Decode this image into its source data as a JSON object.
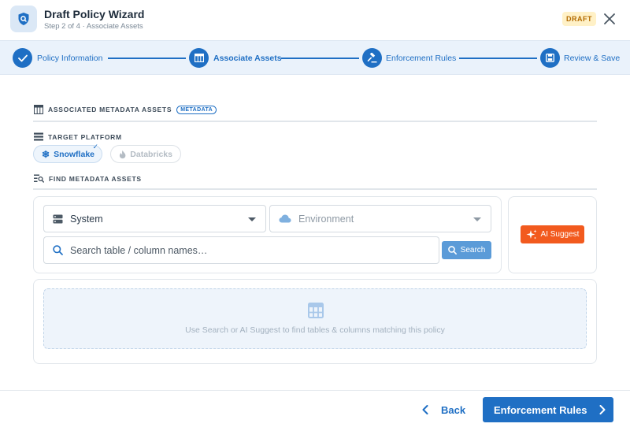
{
  "header": {
    "title": "Draft Policy Wizard",
    "subtitle": "Step 2 of 4 · Associate Assets",
    "status_badge": "DRAFT"
  },
  "stepper": {
    "steps": [
      {
        "label": "Policy Information",
        "state": "complete",
        "icon": "check-icon"
      },
      {
        "label": "Associate Assets",
        "state": "current",
        "icon": "table-icon"
      },
      {
        "label": "Enforcement Rules",
        "state": "upcoming",
        "icon": "gavel-icon"
      },
      {
        "label": "Review & Save",
        "state": "upcoming",
        "icon": "save-icon"
      }
    ]
  },
  "assets_section": {
    "title": "ASSOCIATED METADATA ASSETS",
    "tag": "METADATA"
  },
  "platform_section": {
    "title": "TARGET PLATFORM",
    "options": [
      {
        "label": "Snowflake",
        "selected": true,
        "icon": "snowflake-icon"
      },
      {
        "label": "Databricks",
        "selected": false,
        "icon": "flame-icon"
      }
    ]
  },
  "find_section": {
    "title": "FIND METADATA ASSETS",
    "system_select": "System",
    "environment_select": "Environment",
    "search_placeholder": "Search table / column names…",
    "search_button": "Search",
    "ai_suggest_button": "AI Suggest",
    "empty_message": "Use Search or AI Suggest to find tables & columns matching this policy"
  },
  "footer": {
    "back_label": "Back",
    "next_label": "Enforcement Rules"
  },
  "colors": {
    "primary": "#1f6fc4",
    "stepper_bg": "#eaf2fb",
    "draft_badge_bg": "#fff1c7",
    "ai_button": "#f25a1e"
  }
}
